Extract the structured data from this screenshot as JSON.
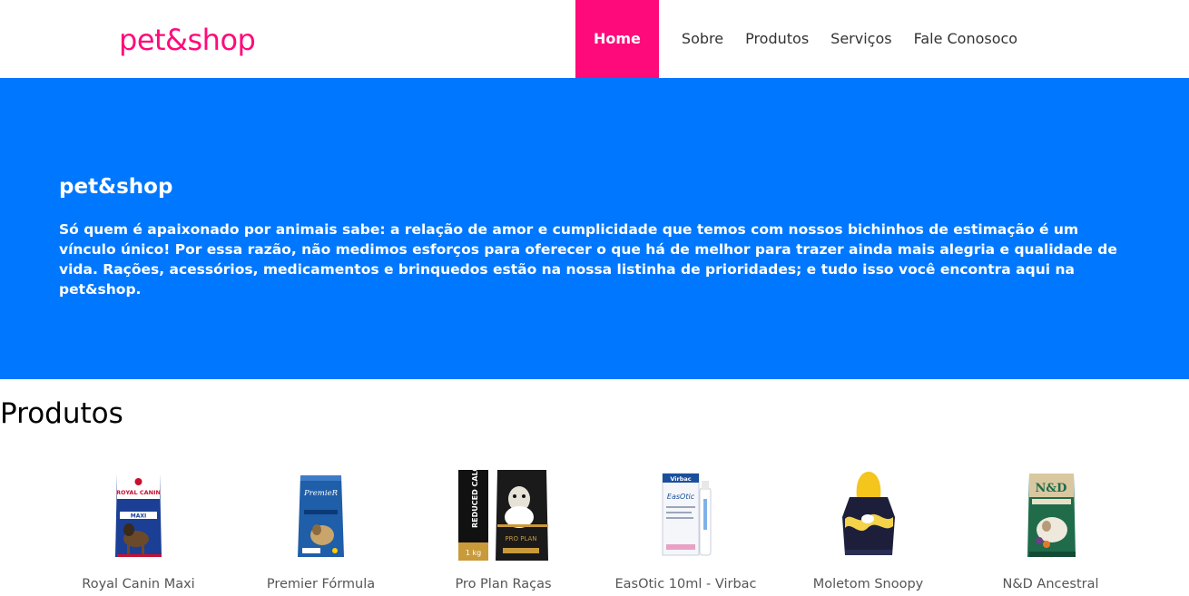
{
  "brand": {
    "name": "pet&shop",
    "color": "#ff0a7a"
  },
  "nav": {
    "items": [
      {
        "label": "Home",
        "active": true
      },
      {
        "label": "Sobre"
      },
      {
        "label": "Produtos"
      },
      {
        "label": "Serviços"
      },
      {
        "label": "Fale Conosoco"
      }
    ]
  },
  "hero": {
    "title": "pet&shop",
    "text": "Só quem é apaixonado por animais sabe: a relação de amor e cumplicidade que temos com nossos bichinhos de estimação é um vínculo único! Por essa razão, não medimos esforços para oferecer o que há de melhor para trazer ainda mais alegria e qualidade de vida. Rações, acessórios, medicamentos e brinquedos estão na nossa listinha de prioridades; e tudo isso você encontra aqui na pet&shop.",
    "background": "#0077ff"
  },
  "products_section": {
    "title": "Produtos",
    "items": [
      {
        "name": "Royal Canin Maxi",
        "image_text": [
          "ROYAL CANIN",
          "MAXI"
        ]
      },
      {
        "name": "Premier Fórmula",
        "image_text": [
          "PremieR"
        ]
      },
      {
        "name": "Pro Plan Raças",
        "image_text": [
          "REDUCED CALORIE",
          "1 kg",
          "PRO PLAN"
        ]
      },
      {
        "name": "EasOtic 10ml - Virbac",
        "image_text": [
          "Virbac",
          "EasOtic"
        ]
      },
      {
        "name": "Moletom Snoopy"
      },
      {
        "name": "N&D Ancestral",
        "image_text": [
          "N&D"
        ]
      }
    ]
  }
}
